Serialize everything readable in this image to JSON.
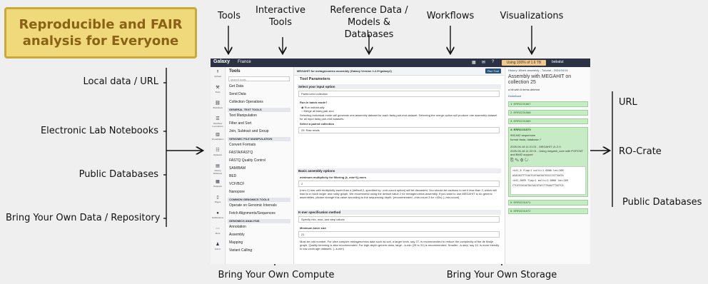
{
  "hero": {
    "title": "Reproducible and FAIR analysis for Everyone"
  },
  "top_labels": {
    "tools": "Tools",
    "interactive_tools": "Interactive Tools",
    "reference_data": "Reference Data / Models & Databases",
    "workflows": "Workflows",
    "visualizations": "Visualizations"
  },
  "inputs": [
    "Local data / URL",
    "Electronic Lab Notebooks",
    "Public Databases",
    "Bring Your Own Data / Repository"
  ],
  "outputs": [
    "URL",
    "RO-Crate",
    "Public Databases"
  ],
  "bottom_labels": {
    "compute": "Bring Your Own Compute",
    "storage": "Bring Your Own Storage"
  },
  "colors": {
    "hero_bg": "#efd97a",
    "hero_text": "#8a6216",
    "masthead": "#2c3143",
    "dataset_ok": "#c7ecc5"
  },
  "galaxy": {
    "brand": "Galaxy",
    "project": "France",
    "usage": "Using 100% of 1.6 TB",
    "user": "bebatut",
    "activity": [
      {
        "icon": "upload-icon",
        "glyph": "⭱",
        "label": "Upload"
      },
      {
        "icon": "wrench-icon",
        "glyph": "⚒",
        "label": "Tools"
      },
      {
        "icon": "workflow-icon",
        "glyph": "⛓",
        "label": "Workflows"
      },
      {
        "icon": "invocations-icon",
        "glyph": "☰",
        "label": "Workflow Invocations"
      },
      {
        "icon": "chart-icon",
        "glyph": "▥",
        "label": "Visualization"
      },
      {
        "icon": "database-icon",
        "glyph": "☷",
        "label": "Datasets"
      },
      {
        "icon": "history-icon",
        "glyph": "▤",
        "label": "History Multiview"
      },
      {
        "icon": "folder-icon",
        "glyph": "▦",
        "label": "Datasets"
      },
      {
        "icon": "pages-icon",
        "glyph": "▯",
        "label": "Pages"
      },
      {
        "icon": "bell-icon",
        "glyph": "●",
        "label": "Notifications"
      },
      {
        "icon": "more-icon",
        "glyph": "⋯",
        "label": "More"
      },
      {
        "icon": "admin-icon",
        "glyph": "♟",
        "label": "Admin"
      }
    ],
    "tool_panel": {
      "title": "Tools",
      "search_placeholder": "search tools",
      "rows": [
        {
          "type": "item",
          "label": "Get Data"
        },
        {
          "type": "item",
          "label": "Send Data"
        },
        {
          "type": "item",
          "label": "Collection Operations"
        },
        {
          "type": "section",
          "label": "GENERAL TEXT TOOLS"
        },
        {
          "type": "item",
          "label": "Text Manipulation"
        },
        {
          "type": "item",
          "label": "Filter and Sort"
        },
        {
          "type": "item",
          "label": "Join, Subtract and Group"
        },
        {
          "type": "section",
          "label": "GENOMIC FILE MANIPULATION"
        },
        {
          "type": "item",
          "label": "Convert Formats"
        },
        {
          "type": "item",
          "label": "FASTA/FASTQ"
        },
        {
          "type": "item",
          "label": "FASTQ Quality Control"
        },
        {
          "type": "item",
          "label": "SAM/BAM"
        },
        {
          "type": "item",
          "label": "BED"
        },
        {
          "type": "item",
          "label": "VCF/BCF"
        },
        {
          "type": "item",
          "label": "Nanopore"
        },
        {
          "type": "section",
          "label": "COMMON GENOMICS TOOLS"
        },
        {
          "type": "item",
          "label": "Operate on Genomic Intervals"
        },
        {
          "type": "item",
          "label": "Fetch Alignments/Sequences"
        },
        {
          "type": "section",
          "label": "GENOMICS ANALYSIS"
        },
        {
          "type": "item",
          "label": "Annotation"
        },
        {
          "type": "item",
          "label": "Assembly"
        },
        {
          "type": "item",
          "label": "Mapping"
        },
        {
          "type": "item",
          "label": "Variant Calling"
        }
      ]
    },
    "tool_form": {
      "tool_name": "MEGAHIT for metagenomics assembly (Galaxy Version 1.2.9+galaxy2)",
      "run_button": "Run Tool",
      "params_title": "Tool Parameters",
      "input_option_label": "Select your input option",
      "input_option_value": "Paired-end collection",
      "batch_label": "Run in batch mode?",
      "radio_1": "Run individually",
      "radio_2": "Merge all fastq pair-end",
      "batch_help": "Selecting individual mode will generate one assembly dataset for each fastq pair-end dataset. Selecting the merge option will produce one assembly dataset for all input fastq pair-end datasets.",
      "collection_label": "Select a paired collection",
      "collection_value": "25: Raw reads",
      "basic_options": "Basic assembly options",
      "multiplicity_label": "minimum multiplicity for filtering (k_min+1)-mers",
      "multiplicity_value": "2",
      "multiplicity_help": "(min=1) mer with multiplicity lower than d (default 2, specified by --min-count option) will be discarded. You should be cautious to set it less than 2, which will lead to a much larger and noisy graph. We recommend using the default value 2 for metagenomics assembly. If you want to use MEGAHIT to do generic assemblies, please change this value according to the sequencing depth. (recommended --min-count 3 for >40x) (--min-count)",
      "kmer_label": "K-mer specification method",
      "kmer_value": "Specify min, max, and step values",
      "min_kmer_label": "Minimum kmer size",
      "min_kmer_value": "21",
      "min_kmer_help": "Must be odd number. For ultra complex metagenomics data such as soil, a larger kmin, say 27, is recommended to reduce the complexity of the de Bruijn graph. Quality trimming is also recommended. For high-depth generic data, large --k-min (25 to 31) is recommended. Smaller --k-step, say 10, is more friendly to low-coverage datasets. (--k-min)"
    },
    "history": {
      "history_link": "History: Mixed assembly - Tutorial - 2024/04/16",
      "title": "Assembly with MEGAHIT on collection 25",
      "size_line": "a bit with 8 items deleted",
      "download": "Download",
      "items": [
        "1: ERR2231567",
        "2: ERR2231568",
        "3: ERR2231569",
        "4: ERR2231570",
        "5: ERR2231571",
        "6: ERR2231572"
      ],
      "expanded": {
        "title": "4: ERR2231570",
        "line1": "995,942 sequences",
        "line2": "format fasta, database ?",
        "line3": "2025-06-18 11:21:51 - MEGAHIT v1.2.9",
        "line4": "2025-06-18 11:22:01 - Using megahit_core with POPCNT and BMI2 support",
        "seq1": ">k41_8 flag=1 multi=1.0000 len=208",
        "seq2": "AGACAGTTTCAATCATAACGATGGCCCGTTAATA",
        "seq3": ">k41_0099 flag=1 multi=2.0000 len=209",
        "seq4": "CTCATCACAGTACGACGTACCTTAAATTTGGTCA"
      }
    }
  }
}
